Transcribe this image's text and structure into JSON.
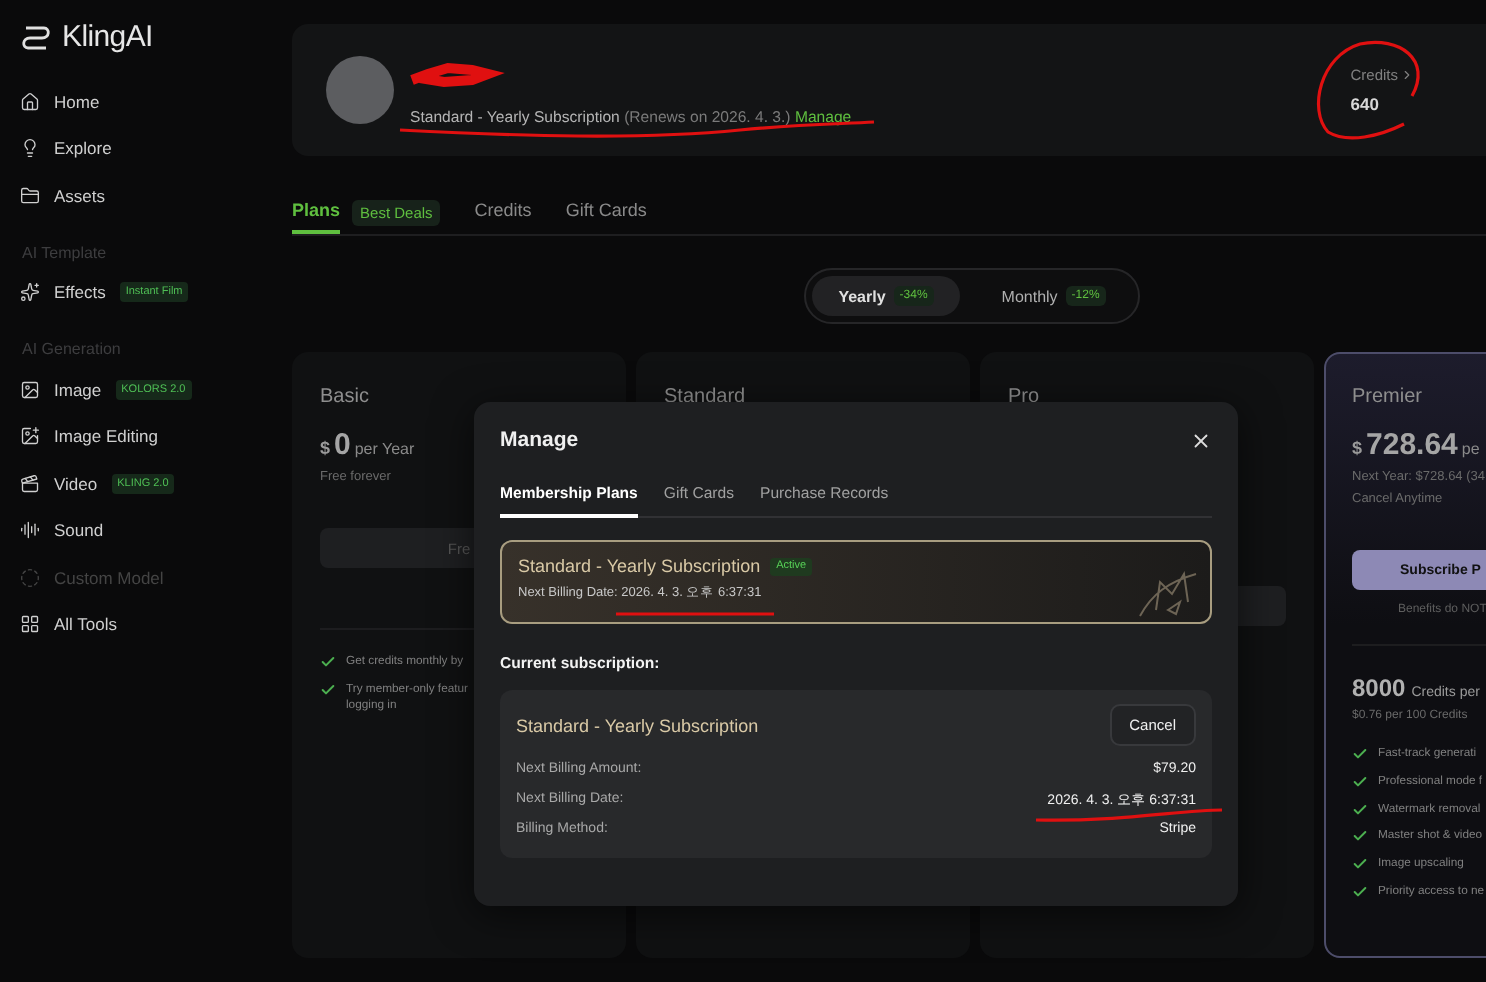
{
  "sidebar": {
    "logo": "KlingAI",
    "sections": [
      {
        "items": [
          {
            "label": "Home",
            "disabled": false
          },
          {
            "label": "Explore",
            "disabled": false
          },
          {
            "label": "Assets",
            "disabled": false
          }
        ]
      },
      {
        "title": "AI Template",
        "items": [
          {
            "label": "Effects",
            "badge": "Instant Film",
            "disabled": false
          }
        ]
      },
      {
        "title": "AI Generation",
        "items": [
          {
            "label": "Image",
            "badge": "KOLORS 2.0",
            "disabled": false
          },
          {
            "label": "Image Editing",
            "disabled": false
          },
          {
            "label": "Video",
            "badge": "KLING 2.0",
            "disabled": false
          },
          {
            "label": "Sound",
            "disabled": false
          },
          {
            "label": "Custom Model",
            "disabled": true
          },
          {
            "label": "All Tools",
            "disabled": false
          }
        ]
      }
    ]
  },
  "account": {
    "plan": "Standard - Yearly Subscription",
    "renewal": "(Renews on 2026. 4. 3.)",
    "manage_link": "Manage",
    "credits_label": "Credits",
    "credits": "640"
  },
  "tabs": [
    {
      "label": "Plans",
      "badge": "Best Deals",
      "selected": true
    },
    {
      "label": "Credits",
      "selected": false
    },
    {
      "label": "Gift Cards",
      "selected": false
    }
  ],
  "billing_toggle": [
    {
      "label": "Yearly",
      "discount": "-34%",
      "selected": true
    },
    {
      "label": "Monthly",
      "discount": "-12%",
      "selected": false
    }
  ],
  "plans": [
    {
      "kind": "basic",
      "title": "Basic",
      "currency": "$",
      "price": "0",
      "period": "per Year",
      "notes": [
        "Free forever"
      ],
      "button": "Fre",
      "features": [
        [
          "Get credits monthly by"
        ],
        [
          "Try member-only featur",
          "logging in"
        ]
      ]
    },
    {
      "kind": "standard",
      "title": "Standard"
    },
    {
      "kind": "pro",
      "title": "Pro"
    },
    {
      "kind": "premier",
      "title": "Premier",
      "currency": "$",
      "price": "728.64",
      "period": "pe",
      "notes": [
        "Next Year: $728.64 (34",
        "Cancel Anytime"
      ],
      "button": "Subscribe P",
      "button_note": "Benefits do NOT",
      "credits": "8000",
      "credits_unit": "Credits per",
      "credits_rate": "$0.76 per 100 Credits",
      "features": [
        [
          "Fast-track generati"
        ],
        [
          "Professional mode f"
        ],
        [
          "Watermark removal"
        ],
        [
          "Master shot & video"
        ],
        [
          "Image upscaling"
        ],
        [
          "Priority access to ne"
        ]
      ]
    }
  ],
  "modal": {
    "title": "Manage",
    "tabs": [
      {
        "label": "Membership Plans",
        "selected": true
      },
      {
        "label": "Gift Cards",
        "selected": false
      },
      {
        "label": "Purchase Records",
        "selected": false
      }
    ],
    "active_plan": {
      "title": "Standard - Yearly Subscription",
      "status": "Active",
      "billing_label": "Next Billing Date:",
      "billing_date": "2026. 4. 3. 오후 6:37:31"
    },
    "current_heading": "Current subscription:",
    "current": {
      "title": "Standard - Yearly Subscription",
      "cancel_button": "Cancel",
      "rows": [
        {
          "label": "Next Billing Amount:",
          "value": "$79.20"
        },
        {
          "label": "Next Billing Date:",
          "value": "2026. 4. 3. 오후 6:37:31"
        },
        {
          "label": "Billing Method:",
          "value": "Stripe"
        }
      ]
    }
  }
}
